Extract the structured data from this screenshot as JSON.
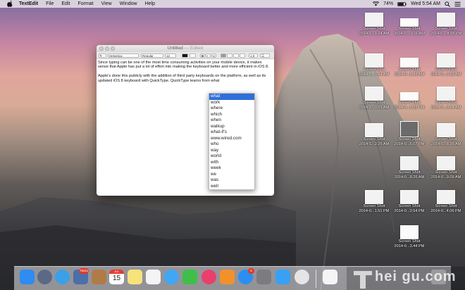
{
  "menubar": {
    "app_name": "TextEdit",
    "items": [
      "File",
      "Edit",
      "Format",
      "View",
      "Window",
      "Help"
    ],
    "status": {
      "battery": "74%",
      "clock": "Wed 5:54 AM"
    }
  },
  "window": {
    "title": "Untitled",
    "title_suffix": "— Edited",
    "toolbar": {
      "font_family": "Helvetica",
      "font_style": "Regular",
      "font_size": "12",
      "line_spacing": "1.0"
    },
    "paragraphs": [
      "Since typing can be one of the most time consuming activities on your mobile device, it makes sense that Apple has put a lot of effort into making the keyboard better and more efficient in iOS 8.",
      "Apple's done this publicly with the addition of third party keyboards on the platform, as well as its updated iOS 8 keyboard with QuickType. QuickType learns from what"
    ]
  },
  "suggestions": {
    "items": [
      "what",
      "work",
      "where",
      "which",
      "when",
      "walkup",
      "what-if's",
      "www.wired.com",
      "who",
      "way",
      "world",
      "with",
      "week",
      "we",
      "was",
      "well"
    ],
    "selected_index": 0
  },
  "desktop_icons": [
    {
      "line1": "Screen Shot",
      "line2": "2014-1...1.24 AM"
    },
    {
      "line1": "Screen Shot",
      "line2": "2014-0....7.11 AM"
    },
    {
      "line1": "Screen Shot",
      "line2": "2014-0....8.58 PM"
    },
    {
      "line1": "Screen Shot",
      "line2": "2014-1...7.24 AM"
    },
    {
      "line1": "Screen Shot",
      "line2": "2014-0...5.48 AM"
    },
    {
      "line1": "Screen Shot",
      "line2": "2014-0...3.18 AM"
    },
    {
      "line1": "Screen Shot",
      "line2": "2014-1...0.01 AM"
    },
    {
      "line1": "Screen Shot",
      "line2": "2014-0...6.25 PM"
    },
    {
      "line1": "Screen Shot",
      "line2": "2014-0...3.14 AM"
    },
    {
      "line1": "Screen Shot",
      "line2": "2014-1...2.25 AM"
    },
    {
      "line1": "Screen Shot",
      "line2": "2014-0...6.07 PM"
    },
    {
      "line1": "Screen Shot",
      "line2": "2014-0...8.35 AM"
    },
    {
      "line1": "Screen Shot",
      "line2": "2014-0...8.26 AM"
    },
    {
      "line1": "Screen Shot",
      "line2": "2014-0...9.09 AM"
    },
    {
      "line1": "Screen Shot",
      "line2": "2014-0...1.51 PM"
    },
    {
      "line1": "Screen Shot",
      "line2": "2014-0...0.54 PM"
    },
    {
      "line1": "Screen Shot",
      "line2": "2014-0...4.06 PM"
    },
    {
      "line1": "Screen Shot",
      "line2": "2014-0...3.44 PM"
    }
  ],
  "dock": {
    "apps": [
      {
        "name": "finder-icon",
        "color": "#2f8cf0"
      },
      {
        "name": "launchpad-icon",
        "color": "#5a6a85"
      },
      {
        "name": "safari-icon",
        "color": "#3aa0e8"
      },
      {
        "name": "photos-icon",
        "color": "#4b6fa8"
      },
      {
        "name": "contacts-icon",
        "color": "#b07b46"
      },
      {
        "name": "calendar-icon",
        "color": "#ffffff"
      },
      {
        "name": "notes-icon",
        "color": "#f6e37a"
      },
      {
        "name": "reminders-icon",
        "color": "#f4f4f4"
      },
      {
        "name": "messages-icon",
        "color": "#3fa7f5"
      },
      {
        "name": "facetime-icon",
        "color": "#3fbf49"
      },
      {
        "name": "itunes-icon",
        "color": "#ea3f6d"
      },
      {
        "name": "ibooks-icon",
        "color": "#f2912c"
      },
      {
        "name": "app-store-icon",
        "color": "#2b8ef2"
      },
      {
        "name": "system-preferences-icon",
        "color": "#7c7c80"
      },
      {
        "name": "twitter-icon",
        "color": "#38a1f3"
      },
      {
        "name": "chrome-icon",
        "color": "#e5e5e5"
      }
    ],
    "photos_badge": "76311",
    "calendar_month": "JUL",
    "calendar_day": "15",
    "appstore_badge": "5"
  },
  "watermark": "hei gu.com"
}
